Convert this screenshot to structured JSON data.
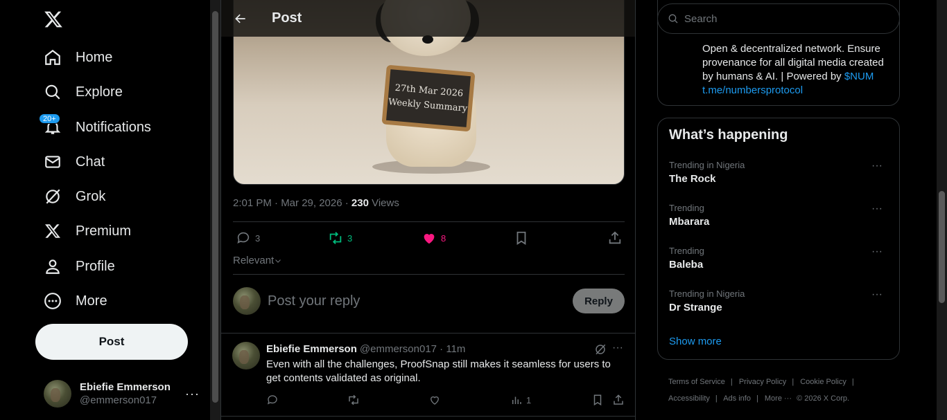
{
  "nav": {
    "items": [
      {
        "label": "Home",
        "icon": "home-icon"
      },
      {
        "label": "Explore",
        "icon": "search-icon"
      },
      {
        "label": "Notifications",
        "icon": "bell-icon",
        "badge": "20+"
      },
      {
        "label": "Chat",
        "icon": "mail-icon"
      },
      {
        "label": "Grok",
        "icon": "grok-icon"
      },
      {
        "label": "Premium",
        "icon": "x-icon"
      },
      {
        "label": "Profile",
        "icon": "person-icon"
      },
      {
        "label": "More",
        "icon": "more-circle-icon"
      }
    ],
    "post_button": "Post"
  },
  "account": {
    "display_name": "Ebiefie Emmerson",
    "handle": "@emmerson017"
  },
  "header": {
    "title": "Post"
  },
  "media": {
    "board_line1": "27th Mar 2026",
    "board_line2": "Weekly Summary"
  },
  "post": {
    "timestamp": "2:01 PM · Mar 29, 2026 · ",
    "views_count": "230",
    "views_label": " Views",
    "replies": "3",
    "reposts": "3",
    "likes": "8",
    "sort_label": "Relevant"
  },
  "composer": {
    "placeholder": "Post your reply",
    "reply_button": "Reply"
  },
  "reply": {
    "display_name": "Ebiefie Emmerson",
    "handle_time": "@emmerson017 · 11m",
    "text": "Even with all the challenges, ProofSnap still makes it seamless for users to get contents validated as original.",
    "views": "1"
  },
  "search": {
    "placeholder": "Search"
  },
  "profile_card": {
    "bio": "Open & decentralized network. Ensure provenance for all digital media created by humans & AI. | Powered by ",
    "link1": "$NUM",
    "link2": "t.me/numbersprotocol"
  },
  "happening": {
    "title": "What’s happening",
    "trends": [
      {
        "context": "Trending in Nigeria",
        "topic": "The Rock"
      },
      {
        "context": "Trending",
        "topic": "Mbarara"
      },
      {
        "context": "Trending",
        "topic": "Baleba"
      },
      {
        "context": "Trending in Nigeria",
        "topic": "Dr Strange"
      }
    ],
    "show_more": "Show more"
  },
  "footer": {
    "terms": "Terms of Service",
    "privacy": "Privacy Policy",
    "cookie": "Cookie Policy",
    "accessibility": "Accessibility",
    "ads": "Ads info",
    "more": "More ···",
    "copyright": "© 2026 X Corp."
  },
  "colors": {
    "accent": "#1d9bf0",
    "repost": "#00ba7c",
    "like": "#f91880",
    "muted": "#71767b",
    "border": "#2f3336"
  }
}
